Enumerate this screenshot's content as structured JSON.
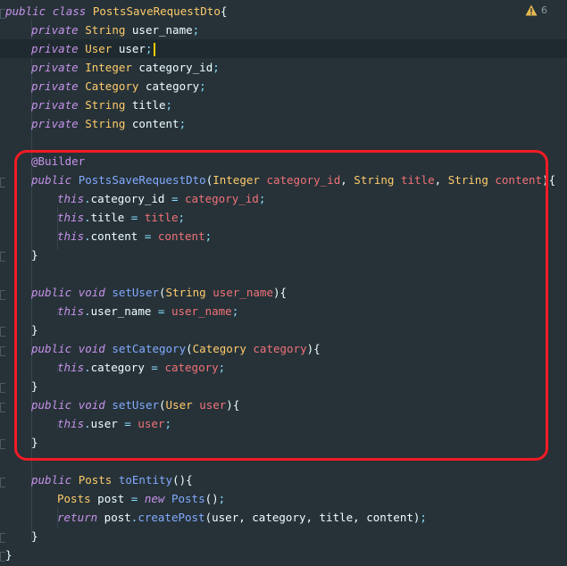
{
  "warning": {
    "icon": "warning-triangle-icon",
    "count": "6"
  },
  "highlight_color": "#F21B25",
  "lines": [
    {
      "indent": 0,
      "tokens": [
        [
          "kw",
          "public"
        ],
        [
          "plain",
          " "
        ],
        [
          "kw",
          "class"
        ],
        [
          "plain",
          " "
        ],
        [
          "type",
          "PostsSaveRequestDto"
        ],
        [
          "plain",
          "{"
        ]
      ]
    },
    {
      "indent": 1,
      "tokens": [
        [
          "kw",
          "private"
        ],
        [
          "plain",
          " "
        ],
        [
          "type",
          "String"
        ],
        [
          "plain",
          " user_name"
        ],
        [
          "punc",
          ";"
        ]
      ]
    },
    {
      "indent": 1,
      "tokens": [
        [
          "kw",
          "private"
        ],
        [
          "plain",
          " "
        ],
        [
          "type",
          "User"
        ],
        [
          "plain",
          " user"
        ],
        [
          "punc",
          ";"
        ]
      ]
    },
    {
      "indent": 1,
      "tokens": [
        [
          "kw",
          "private"
        ],
        [
          "plain",
          " "
        ],
        [
          "type",
          "Integer"
        ],
        [
          "plain",
          " category_id"
        ],
        [
          "punc",
          ";"
        ]
      ]
    },
    {
      "indent": 1,
      "tokens": [
        [
          "kw",
          "private"
        ],
        [
          "plain",
          " "
        ],
        [
          "type",
          "Category"
        ],
        [
          "plain",
          " category"
        ],
        [
          "punc",
          ";"
        ]
      ]
    },
    {
      "indent": 1,
      "tokens": [
        [
          "kw",
          "private"
        ],
        [
          "plain",
          " "
        ],
        [
          "type",
          "String"
        ],
        [
          "plain",
          " title"
        ],
        [
          "punc",
          ";"
        ]
      ]
    },
    {
      "indent": 1,
      "tokens": [
        [
          "kw",
          "private"
        ],
        [
          "plain",
          " "
        ],
        [
          "type",
          "String"
        ],
        [
          "plain",
          " content"
        ],
        [
          "punc",
          ";"
        ]
      ]
    },
    {
      "indent": 0,
      "tokens": []
    },
    {
      "indent": 1,
      "tokens": [
        [
          "anno",
          "@Builder"
        ]
      ]
    },
    {
      "indent": 1,
      "tokens": [
        [
          "kw",
          "public"
        ],
        [
          "plain",
          " "
        ],
        [
          "fn",
          "PostsSaveRequestDto"
        ],
        [
          "plain",
          "("
        ],
        [
          "type",
          "Integer"
        ],
        [
          "plain",
          " "
        ],
        [
          "param",
          "category_id"
        ],
        [
          "plain",
          ", "
        ],
        [
          "type",
          "String"
        ],
        [
          "plain",
          " "
        ],
        [
          "param",
          "title"
        ],
        [
          "plain",
          ", "
        ],
        [
          "type",
          "String"
        ],
        [
          "plain",
          " "
        ],
        [
          "param",
          "content"
        ],
        [
          "plain",
          "){"
        ]
      ]
    },
    {
      "indent": 2,
      "tokens": [
        [
          "kw",
          "this"
        ],
        [
          "punc",
          "."
        ],
        [
          "plain",
          "category_id "
        ],
        [
          "punc",
          "="
        ],
        [
          "plain",
          " "
        ],
        [
          "param",
          "category_id"
        ],
        [
          "punc",
          ";"
        ]
      ]
    },
    {
      "indent": 2,
      "tokens": [
        [
          "kw",
          "this"
        ],
        [
          "punc",
          "."
        ],
        [
          "plain",
          "title "
        ],
        [
          "punc",
          "="
        ],
        [
          "plain",
          " "
        ],
        [
          "param",
          "title"
        ],
        [
          "punc",
          ";"
        ]
      ]
    },
    {
      "indent": 2,
      "tokens": [
        [
          "kw",
          "this"
        ],
        [
          "punc",
          "."
        ],
        [
          "plain",
          "content "
        ],
        [
          "punc",
          "="
        ],
        [
          "plain",
          " "
        ],
        [
          "param",
          "content"
        ],
        [
          "punc",
          ";"
        ]
      ]
    },
    {
      "indent": 1,
      "tokens": [
        [
          "plain",
          "}"
        ]
      ]
    },
    {
      "indent": 0,
      "tokens": []
    },
    {
      "indent": 1,
      "tokens": [
        [
          "kw",
          "public"
        ],
        [
          "plain",
          " "
        ],
        [
          "kw",
          "void"
        ],
        [
          "plain",
          " "
        ],
        [
          "fn",
          "setUser"
        ],
        [
          "plain",
          "("
        ],
        [
          "type",
          "String"
        ],
        [
          "plain",
          " "
        ],
        [
          "param",
          "user_name"
        ],
        [
          "plain",
          "){"
        ]
      ]
    },
    {
      "indent": 2,
      "tokens": [
        [
          "kw",
          "this"
        ],
        [
          "punc",
          "."
        ],
        [
          "plain",
          "user_name "
        ],
        [
          "punc",
          "="
        ],
        [
          "plain",
          " "
        ],
        [
          "param",
          "user_name"
        ],
        [
          "punc",
          ";"
        ]
      ]
    },
    {
      "indent": 1,
      "tokens": [
        [
          "plain",
          "}"
        ]
      ]
    },
    {
      "indent": 1,
      "tokens": [
        [
          "kw",
          "public"
        ],
        [
          "plain",
          " "
        ],
        [
          "kw",
          "void"
        ],
        [
          "plain",
          " "
        ],
        [
          "fn",
          "setCategory"
        ],
        [
          "plain",
          "("
        ],
        [
          "type",
          "Category"
        ],
        [
          "plain",
          " "
        ],
        [
          "param",
          "category"
        ],
        [
          "plain",
          "){"
        ]
      ]
    },
    {
      "indent": 2,
      "tokens": [
        [
          "kw",
          "this"
        ],
        [
          "punc",
          "."
        ],
        [
          "plain",
          "category "
        ],
        [
          "punc",
          "="
        ],
        [
          "plain",
          " "
        ],
        [
          "param",
          "category"
        ],
        [
          "punc",
          ";"
        ]
      ]
    },
    {
      "indent": 1,
      "tokens": [
        [
          "plain",
          "}"
        ]
      ]
    },
    {
      "indent": 1,
      "tokens": [
        [
          "kw",
          "public"
        ],
        [
          "plain",
          " "
        ],
        [
          "kw",
          "void"
        ],
        [
          "plain",
          " "
        ],
        [
          "fn",
          "setUser"
        ],
        [
          "plain",
          "("
        ],
        [
          "type",
          "User"
        ],
        [
          "plain",
          " "
        ],
        [
          "param",
          "user"
        ],
        [
          "plain",
          "){"
        ]
      ]
    },
    {
      "indent": 2,
      "tokens": [
        [
          "kw",
          "this"
        ],
        [
          "punc",
          "."
        ],
        [
          "plain",
          "user "
        ],
        [
          "punc",
          "="
        ],
        [
          "plain",
          " "
        ],
        [
          "param",
          "user"
        ],
        [
          "punc",
          ";"
        ]
      ]
    },
    {
      "indent": 1,
      "tokens": [
        [
          "plain",
          "}"
        ]
      ]
    },
    {
      "indent": 0,
      "tokens": []
    },
    {
      "indent": 1,
      "tokens": [
        [
          "kw",
          "public"
        ],
        [
          "plain",
          " "
        ],
        [
          "type",
          "Posts"
        ],
        [
          "plain",
          " "
        ],
        [
          "fn",
          "toEntity"
        ],
        [
          "plain",
          "(){"
        ]
      ]
    },
    {
      "indent": 2,
      "tokens": [
        [
          "type",
          "Posts"
        ],
        [
          "plain",
          " post "
        ],
        [
          "punc",
          "="
        ],
        [
          "plain",
          " "
        ],
        [
          "kw",
          "new"
        ],
        [
          "plain",
          " "
        ],
        [
          "fn",
          "Posts"
        ],
        [
          "plain",
          "()"
        ],
        [
          "punc",
          ";"
        ]
      ]
    },
    {
      "indent": 2,
      "tokens": [
        [
          "kw",
          "return"
        ],
        [
          "plain",
          " post"
        ],
        [
          "punc",
          "."
        ],
        [
          "fn",
          "createPost"
        ],
        [
          "plain",
          "(user, category, title, content)"
        ],
        [
          "punc",
          ";"
        ]
      ]
    },
    {
      "indent": 1,
      "tokens": [
        [
          "plain",
          "}"
        ]
      ]
    },
    {
      "indent": 0,
      "tokens": [
        [
          "plain",
          "}"
        ]
      ]
    }
  ]
}
